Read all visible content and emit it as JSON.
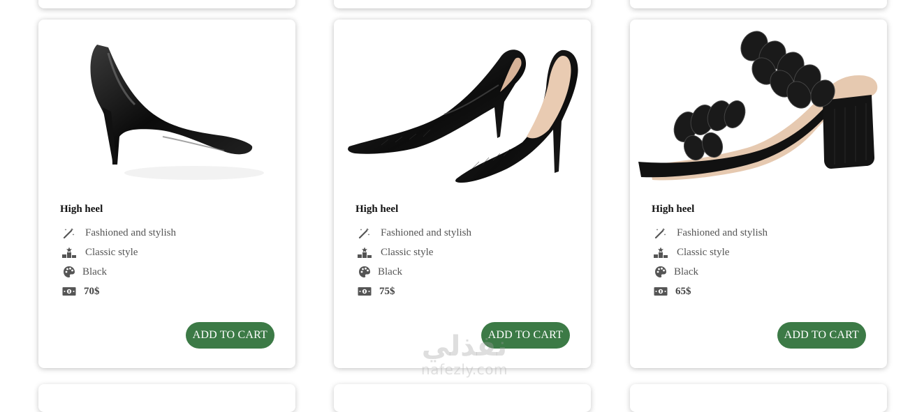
{
  "products": [
    {
      "title": "High heel",
      "image": "black-patent-stiletto-pump",
      "features": {
        "style": "Fashioned and stylish",
        "category": "Classic style",
        "color": "Black",
        "price": "70$"
      },
      "button_label": "ADD TO CART"
    },
    {
      "title": "High heel",
      "image": "black-croc-embossed-pumps-pair",
      "features": {
        "style": "Fashioned and stylish",
        "category": "Classic style",
        "color": "Black",
        "price": "75$"
      },
      "button_label": "ADD TO CART"
    },
    {
      "title": "High heel",
      "image": "black-braided-strap-block-heel-sandal",
      "features": {
        "style": "Fashioned and stylish",
        "category": "Classic style",
        "color": "Black",
        "price": "65$"
      },
      "button_label": "ADD TO CART"
    }
  ],
  "icons": {
    "style": "magic-wand-icon",
    "category": "ranking-podium-icon",
    "color": "palette-icon",
    "price": "money-bill-icon"
  },
  "watermark": {
    "logo_text": "نفذلي",
    "url": "nafezly.com"
  },
  "colors": {
    "button": "#3c7a46",
    "icon": "#555555"
  }
}
